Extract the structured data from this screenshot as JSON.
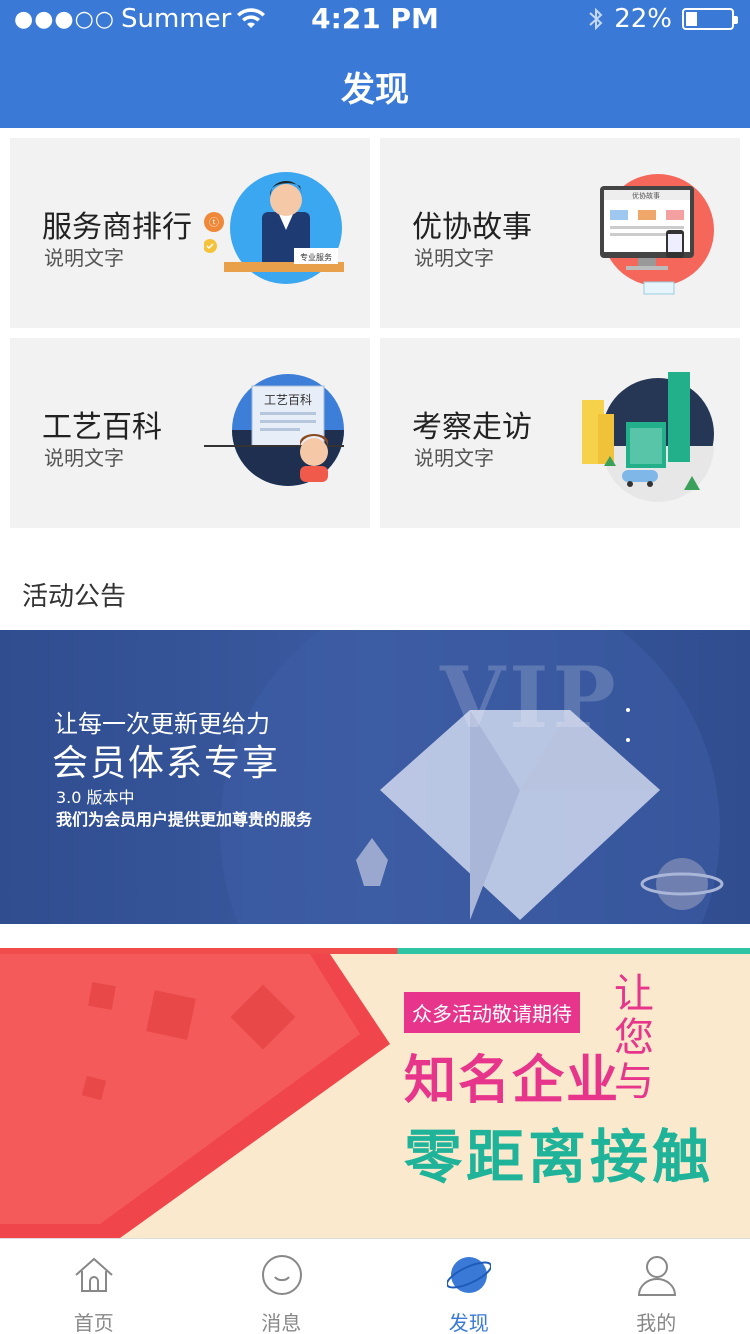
{
  "status_bar": {
    "carrier": "Summer",
    "signal_dots": "●●●○○",
    "time": "4:21 PM",
    "battery": "22%",
    "battery_level": 0.22
  },
  "nav": {
    "title": "发现"
  },
  "grid": [
    {
      "title": "服务商排行",
      "subtitle": "说明文字",
      "badge": "专业服务"
    },
    {
      "title": "优协故事",
      "subtitle": "说明文字",
      "badge": "优协故事"
    },
    {
      "title": "工艺百科",
      "subtitle": "说明文字",
      "badge": "工艺百科"
    },
    {
      "title": "考察走访",
      "subtitle": "说明文字"
    }
  ],
  "section": {
    "title": "活动公告"
  },
  "banner_vip": {
    "line1": "让每一次更新更给力",
    "line2": "会员体系专享",
    "line3": "3.0 版本中",
    "line4": "我们为会员用户提供更加尊贵的服务",
    "watermark": "VIP"
  },
  "banner_event": {
    "tag": "众多活动敬请期待",
    "line1": "知名企业",
    "line2": "零距离接触",
    "vertical": "让您与"
  },
  "tabbar": [
    {
      "label": "首页",
      "icon": "home-icon"
    },
    {
      "label": "消息",
      "icon": "message-icon"
    },
    {
      "label": "发现",
      "icon": "planet-icon",
      "active": true
    },
    {
      "label": "我的",
      "icon": "profile-icon"
    }
  ],
  "colors": {
    "primary": "#3a7ad6",
    "card_bg": "#f2f2f2",
    "event_pink": "#e8358c",
    "event_green": "#1fb39a"
  }
}
